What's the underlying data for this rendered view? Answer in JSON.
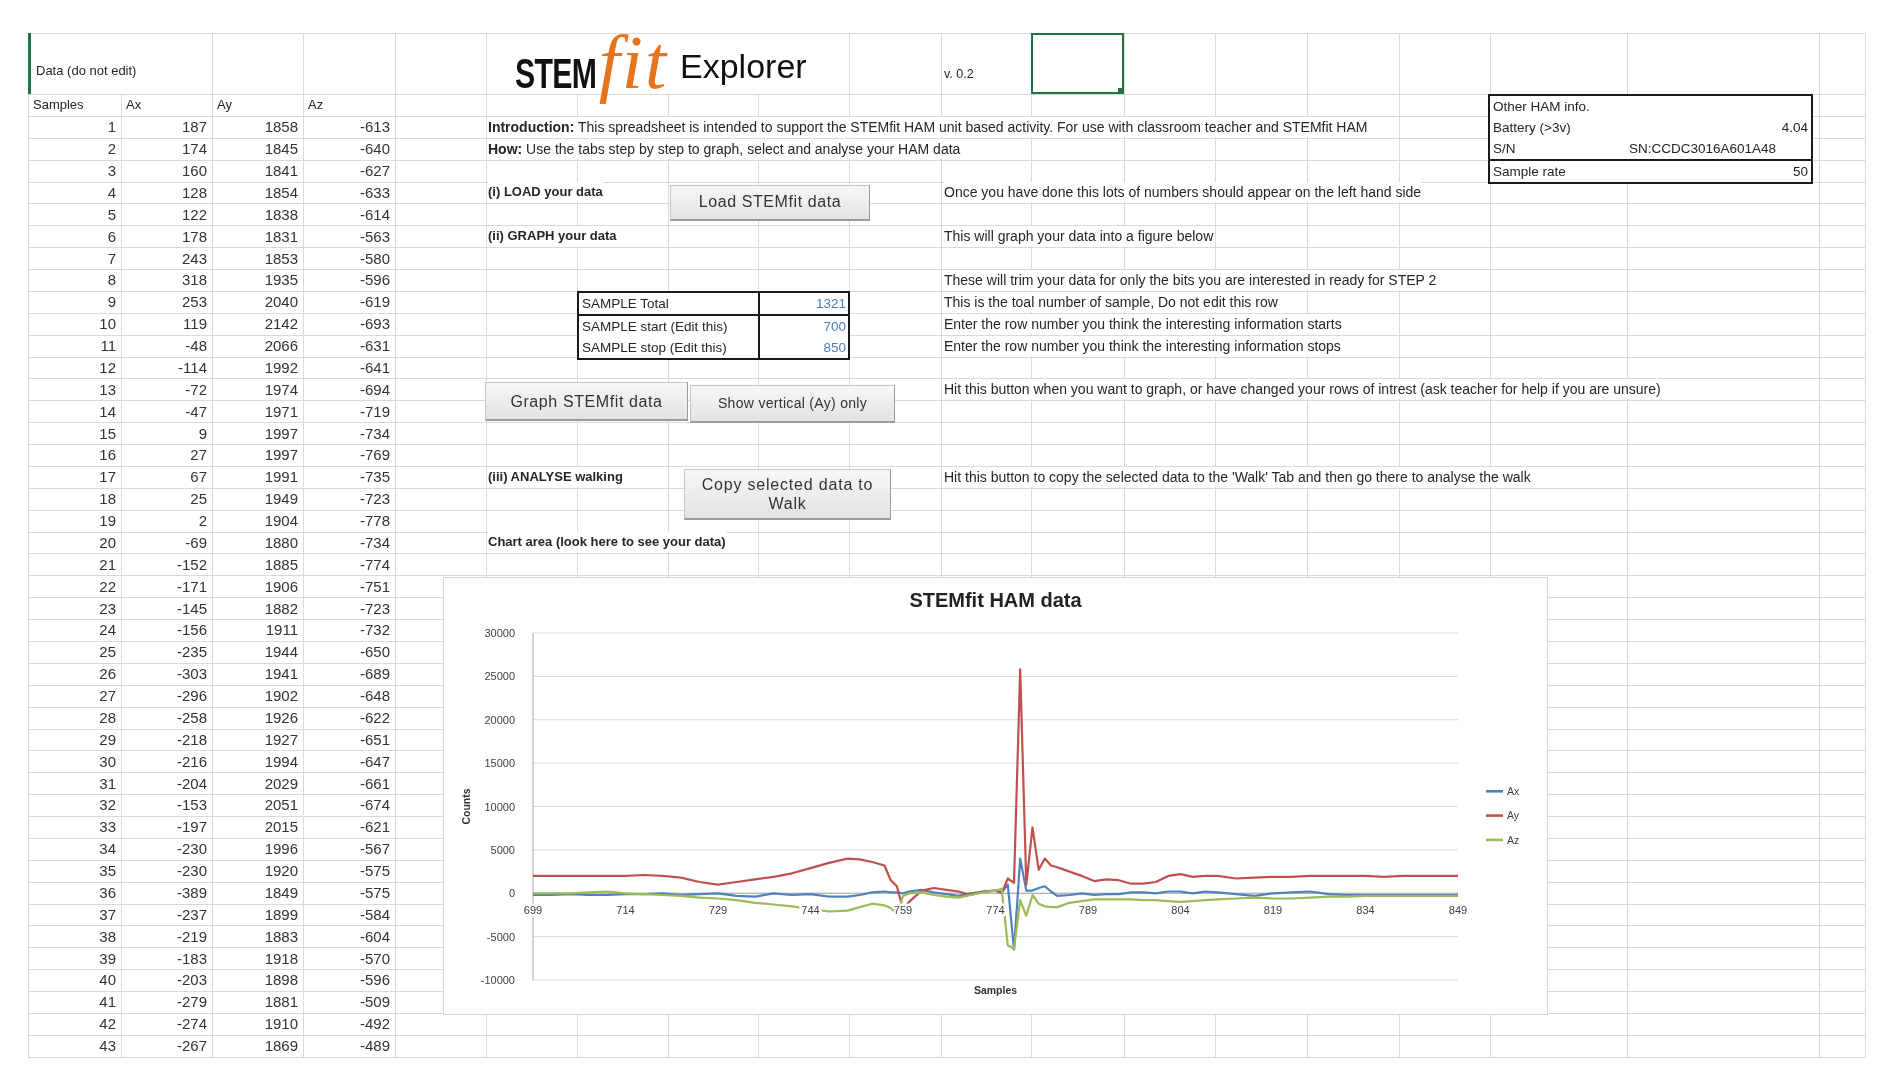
{
  "data_panel": {
    "title": "Data (do not edit)",
    "columns": [
      "Samples",
      "Ax",
      "Ay",
      "Az"
    ],
    "rows": [
      [
        "1",
        "187",
        "1858",
        "-613"
      ],
      [
        "2",
        "174",
        "1845",
        "-640"
      ],
      [
        "3",
        "160",
        "1841",
        "-627"
      ],
      [
        "4",
        "128",
        "1854",
        "-633"
      ],
      [
        "5",
        "122",
        "1838",
        "-614"
      ],
      [
        "6",
        "178",
        "1831",
        "-563"
      ],
      [
        "7",
        "243",
        "1853",
        "-580"
      ],
      [
        "8",
        "318",
        "1935",
        "-596"
      ],
      [
        "9",
        "253",
        "2040",
        "-619"
      ],
      [
        "10",
        "119",
        "2142",
        "-693"
      ],
      [
        "11",
        "-48",
        "2066",
        "-631"
      ],
      [
        "12",
        "-114",
        "1992",
        "-641"
      ],
      [
        "13",
        "-72",
        "1974",
        "-694"
      ],
      [
        "14",
        "-47",
        "1971",
        "-719"
      ],
      [
        "15",
        "9",
        "1997",
        "-734"
      ],
      [
        "16",
        "27",
        "1997",
        "-769"
      ],
      [
        "17",
        "67",
        "1991",
        "-735"
      ],
      [
        "18",
        "25",
        "1949",
        "-723"
      ],
      [
        "19",
        "2",
        "1904",
        "-778"
      ],
      [
        "20",
        "-69",
        "1880",
        "-734"
      ],
      [
        "21",
        "-152",
        "1885",
        "-774"
      ],
      [
        "22",
        "-171",
        "1906",
        "-751"
      ],
      [
        "23",
        "-145",
        "1882",
        "-723"
      ],
      [
        "24",
        "-156",
        "1911",
        "-732"
      ],
      [
        "25",
        "-235",
        "1944",
        "-650"
      ],
      [
        "26",
        "-303",
        "1941",
        "-689"
      ],
      [
        "27",
        "-296",
        "1902",
        "-648"
      ],
      [
        "28",
        "-258",
        "1926",
        "-622"
      ],
      [
        "29",
        "-218",
        "1927",
        "-651"
      ],
      [
        "30",
        "-216",
        "1994",
        "-647"
      ],
      [
        "31",
        "-204",
        "2029",
        "-661"
      ],
      [
        "32",
        "-153",
        "2051",
        "-674"
      ],
      [
        "33",
        "-197",
        "2015",
        "-621"
      ],
      [
        "34",
        "-230",
        "1996",
        "-567"
      ],
      [
        "35",
        "-230",
        "1920",
        "-575"
      ],
      [
        "36",
        "-389",
        "1849",
        "-575"
      ],
      [
        "37",
        "-237",
        "1899",
        "-584"
      ],
      [
        "38",
        "-219",
        "1883",
        "-604"
      ],
      [
        "39",
        "-183",
        "1918",
        "-570"
      ],
      [
        "40",
        "-203",
        "1898",
        "-596"
      ],
      [
        "41",
        "-279",
        "1881",
        "-509"
      ],
      [
        "42",
        "-274",
        "1910",
        "-492"
      ],
      [
        "43",
        "-267",
        "1869",
        "-489"
      ]
    ]
  },
  "header": {
    "logo": {
      "wordmark": "STEM",
      "script": "fit"
    },
    "title": "Explorer",
    "version": "v. 0.2",
    "active_cell": {
      "selected": true
    }
  },
  "ham_info": {
    "title": "Other HAM info.",
    "rows": [
      {
        "label": "Battery (>3v)",
        "value": "4.04"
      },
      {
        "label": "S/N",
        "value": "SN:CCDC3016A601A48"
      },
      {
        "label": "Sample rate",
        "value": "50"
      }
    ]
  },
  "intro": [
    "**Introduction:** This spreadsheet is intended to support the STEMfit HAM unit based activity. For use with classroom teacher and STEMfit HAM",
    "**How:** Use the tabs step by step to graph, select and analyse your HAM data"
  ],
  "steps": [
    {
      "label": "(i) LOAD your data",
      "buttons": [
        "Load STEMfit data"
      ],
      "note": "Once you have done this lots of numbers should appear on the left hand side"
    },
    {
      "label": "(ii) GRAPH your data",
      "note": "This will graph your data into a figure below"
    },
    {
      "label": "(iii) ANALYSE walking",
      "buttons": [
        "Copy selected data to Walk"
      ],
      "note": "Hit this button to copy the selected data to the 'Walk' Tab and then go there to analyse the walk"
    }
  ],
  "sample_range": {
    "note": "These will trim your data for only the bits you are interested in ready for STEP 2",
    "rows": [
      {
        "label": "SAMPLE Total",
        "value": "1321",
        "note": "This is the toal number of sample, Do not edit this row"
      },
      {
        "label": "SAMPLE start (Edit this)",
        "value": "700",
        "note": "Enter the row number you think the interesting information starts"
      },
      {
        "label": "SAMPLE stop (Edit this)",
        "value": "850",
        "note": "Enter the row number you think the interesting information stops"
      }
    ]
  },
  "graph_controls": {
    "buttons": [
      "Graph STEMfit data",
      "Show vertical (Ay) only"
    ],
    "note": "Hit this button when you want to graph, or have changed your rows of intrest (ask teacher for help if you are unsure)"
  },
  "chart_area_label": "Chart area (look here to see your data)",
  "chart": {
    "chart_data": {
      "type": "line",
      "title": "STEMfit HAM data",
      "xlabel": "Samples",
      "ylabel": "Counts",
      "x": [
        699,
        702,
        705,
        708,
        711,
        714,
        717,
        720,
        723,
        726,
        729,
        732,
        735,
        738,
        741,
        744,
        747,
        750,
        752,
        754,
        756,
        757,
        758,
        759,
        760,
        762,
        764,
        766,
        768,
        770,
        772,
        774,
        775,
        776,
        777,
        778,
        779,
        780,
        781,
        782,
        783,
        784,
        786,
        788,
        790,
        792,
        794,
        796,
        798,
        800,
        802,
        804,
        806,
        808,
        810,
        813,
        816,
        819,
        822,
        825,
        828,
        831,
        834,
        837,
        840,
        843,
        846,
        849
      ],
      "series": [
        {
          "name": "Ax",
          "color": "#4f81bd",
          "values": [
            -200,
            -200,
            -100,
            -200,
            -200,
            -100,
            -100,
            0,
            -200,
            -100,
            0,
            -300,
            -400,
            0,
            -200,
            -100,
            -400,
            -400,
            -200,
            100,
            200,
            100,
            100,
            0,
            200,
            400,
            100,
            -100,
            -300,
            0,
            200,
            300,
            100,
            1000,
            -6500,
            4000,
            300,
            300,
            600,
            800,
            200,
            -300,
            -200,
            0,
            -200,
            -100,
            -100,
            100,
            100,
            0,
            200,
            200,
            0,
            200,
            100,
            -100,
            -300,
            0,
            100,
            200,
            -100,
            -200,
            -200,
            -200,
            -200,
            -200,
            -200,
            -200
          ]
        },
        {
          "name": "Ay",
          "color": "#c0504d",
          "values": [
            2000,
            2000,
            2000,
            2000,
            2000,
            2000,
            2100,
            2000,
            1800,
            1300,
            1000,
            1300,
            1600,
            1900,
            2300,
            2900,
            3500,
            4000,
            3900,
            3600,
            3200,
            1500,
            800,
            -1800,
            -1000,
            300,
            600,
            400,
            200,
            -200,
            200,
            300,
            0,
            1700,
            1200,
            25800,
            1000,
            7600,
            2700,
            4000,
            3200,
            3000,
            2500,
            2000,
            1400,
            1600,
            1500,
            1100,
            1100,
            1300,
            2000,
            2200,
            1900,
            2000,
            2000,
            1700,
            1800,
            1900,
            1900,
            2000,
            2000,
            2000,
            2000,
            1900,
            2000,
            2000,
            2000,
            2000
          ]
        },
        {
          "name": "Az",
          "color": "#9bbb59",
          "values": [
            0,
            0,
            0,
            100,
            200,
            0,
            -100,
            -200,
            -300,
            -500,
            -600,
            -800,
            -1100,
            -1300,
            -1500,
            -1800,
            -2100,
            -2000,
            -1600,
            -1200,
            -1400,
            -1700,
            -2400,
            -300,
            0,
            100,
            -200,
            -400,
            -500,
            -200,
            100,
            300,
            500,
            -6000,
            -6400,
            -800,
            -2600,
            -200,
            -1200,
            -1500,
            -1600,
            -1600,
            -1100,
            -900,
            -700,
            -700,
            -700,
            -700,
            -800,
            -800,
            -900,
            -1000,
            -900,
            -800,
            -700,
            -600,
            -500,
            -600,
            -600,
            -500,
            -400,
            -400,
            -300,
            -300,
            -300,
            -300,
            -300,
            -300
          ]
        }
      ],
      "xlim": [
        699,
        849
      ],
      "ylim": [
        -10000,
        30000
      ],
      "xticks": [
        699,
        714,
        729,
        744,
        759,
        774,
        789,
        804,
        819,
        834,
        849
      ],
      "yticks": [
        -10000,
        -5000,
        0,
        5000,
        10000,
        15000,
        20000,
        25000,
        30000
      ],
      "grid": true,
      "legend": true
    }
  }
}
